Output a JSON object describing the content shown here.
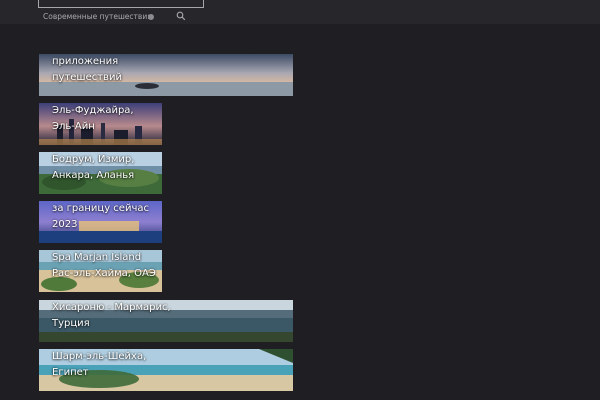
{
  "header": {
    "site_name": "Современные путешествия"
  },
  "cards": [
    {
      "title": "приложения\nпутешествий"
    },
    {
      "title": "Эль-Фуджайра,\nЭль-Айн"
    },
    {
      "title": "Бодрум, Измир,\nАнкара, Аланья"
    },
    {
      "title": "за границу сейчас\n2023"
    },
    {
      "title": "Spa Marjan Island\nРас-эль-Хайма, ОАЭ"
    },
    {
      "title": "Хисароню - Мармарис,\nТурция"
    },
    {
      "title": "Шарм-эль-Шейха,\nЕгипет"
    }
  ]
}
